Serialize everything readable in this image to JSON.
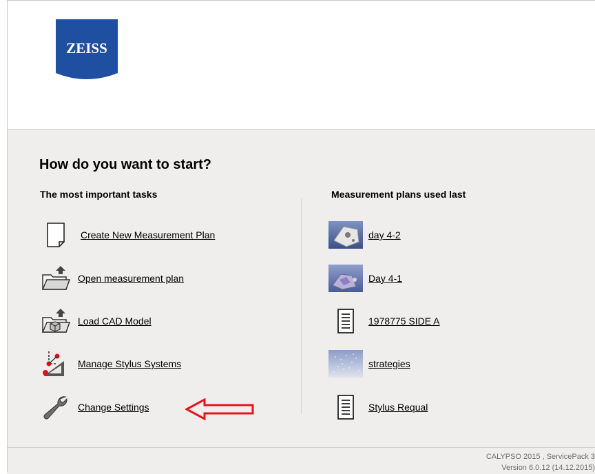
{
  "brand": {
    "logo_text": "ZEISS",
    "logo_color": "#1e4fa0"
  },
  "start": {
    "title": "How do you want to start?",
    "tasks_heading": "The most important tasks",
    "recent_heading": "Measurement plans used last",
    "tasks": [
      {
        "label": "Create New Measurement Plan",
        "icon": "new-document-icon"
      },
      {
        "label": "Open measurement plan",
        "icon": "open-folder-icon"
      },
      {
        "label": "Load CAD Model",
        "icon": "cad-model-icon"
      },
      {
        "label": "Manage Stylus Systems",
        "icon": "stylus-system-icon"
      },
      {
        "label": "Change Settings",
        "icon": "wrench-icon"
      }
    ],
    "recent": [
      {
        "label": "day 4-2",
        "icon": "part-thumbnail"
      },
      {
        "label": "Day 4-1",
        "icon": "part-thumbnail"
      },
      {
        "label": "1978775 SIDE A",
        "icon": "document-icon"
      },
      {
        "label": "strategies",
        "icon": "point-cloud-thumbnail"
      },
      {
        "label": "Stylus Requal",
        "icon": "document-icon"
      }
    ]
  },
  "annotation": {
    "arrow_color": "#e8141c"
  },
  "footer": {
    "line1": "CALYPSO 2015 , ServicePack 3",
    "line2": "Version 6.0.12 (14.12.2015)"
  }
}
